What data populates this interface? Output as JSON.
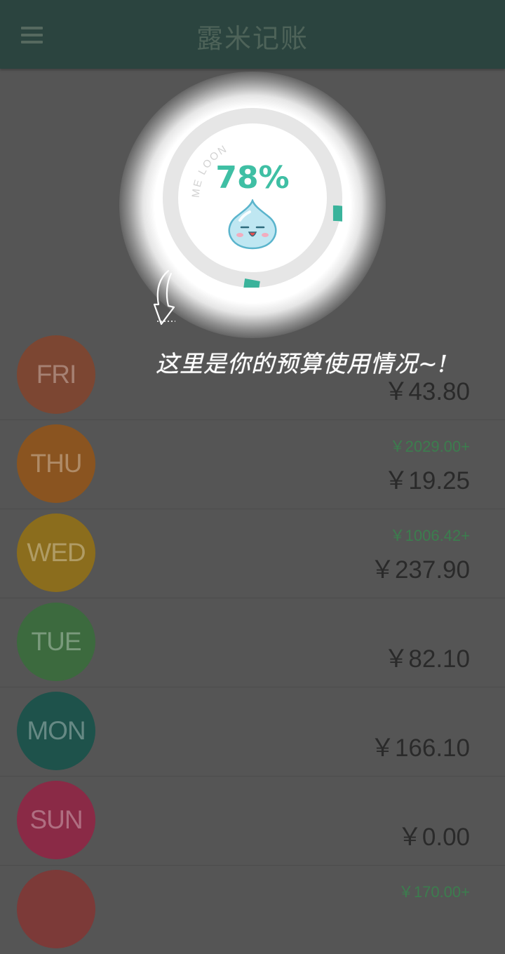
{
  "appbar": {
    "title": "露米记账",
    "menu_icon": "hamburger-menu-icon"
  },
  "budget": {
    "percent_text": "78%",
    "percent_used": 0.78,
    "ring_caption": "ME LOON",
    "ring_color": "#3ab39b",
    "mascot_icon": "water-drop-mascot-icon"
  },
  "hint": {
    "text": "这里是你的预算使用情况~!",
    "arrow_icon": "hand-drawn-arrow-icon"
  },
  "days": [
    {
      "label": "FRI",
      "color": "#7c4632",
      "income": "",
      "amount": "￥43.80"
    },
    {
      "label": "THU",
      "color": "#8a5420",
      "income": "￥2029.00+",
      "amount": "￥19.25"
    },
    {
      "label": "WED",
      "color": "#8b6d1d",
      "income": "￥1006.42+",
      "amount": "￥237.90"
    },
    {
      "label": "TUE",
      "color": "#3c6a3e",
      "income": "",
      "amount": "￥82.10"
    },
    {
      "label": "MON",
      "color": "#1e524b",
      "income": "",
      "amount": "￥166.10"
    },
    {
      "label": "SUN",
      "color": "#8a2a46",
      "income": "",
      "amount": "￥0.00"
    },
    {
      "label": "",
      "color": "#7c3a38",
      "income": "￥170.00+",
      "amount": ""
    }
  ]
}
